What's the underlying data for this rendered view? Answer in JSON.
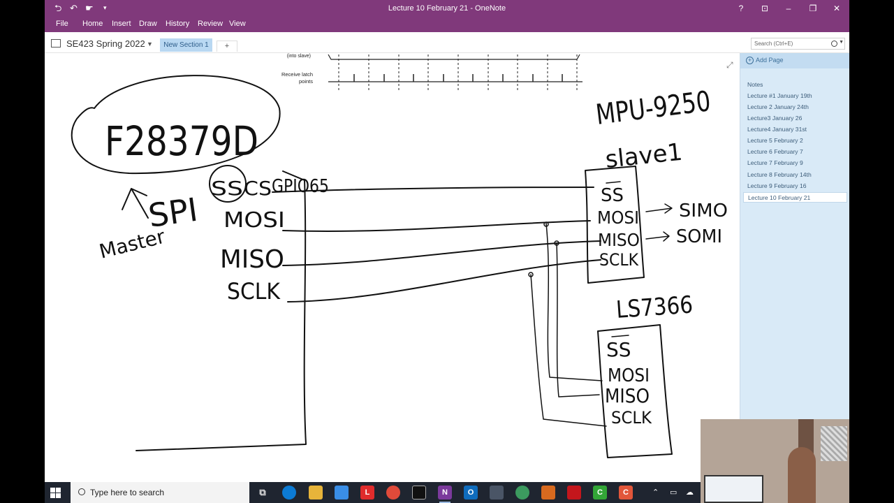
{
  "window": {
    "title": "Lecture 10 February 21 - OneNote",
    "controls": {
      "help": "?",
      "fullscreen": "⊡",
      "minimize": "–",
      "restore": "❐",
      "close": "✕"
    }
  },
  "quick_access": {
    "back": "⮌",
    "undo": "↶",
    "touch": "☛",
    "more": "▾"
  },
  "ribbon": {
    "tabs": [
      "File",
      "Home",
      "Insert",
      "Draw",
      "History",
      "Review",
      "View"
    ]
  },
  "notebook": {
    "name": "SE423 Spring 2022",
    "active_section": "New Section 1",
    "add_section": "+"
  },
  "search": {
    "placeholder": "Search (Ctrl+E)"
  },
  "pages": {
    "add_page": "Add Page",
    "items": [
      "Notes",
      "Lecture #1 January 19th",
      "Lecture 2 January 24th",
      "Lecture3  January 26",
      "Lecture4 January 31st",
      "Lecture 5 February 2",
      "Lecture 6 February 7",
      "Lecture 7 February 9",
      "Lecture 8 February 14th",
      "Lecture 9 February 16",
      "Lecture 10 February 21"
    ],
    "active_index": 10
  },
  "diagram_snippet": {
    "top_label": "(into slave)",
    "receive_label_1": "Receive latch",
    "receive_label_2": "points"
  },
  "ink": {
    "master_chip": "F28379D",
    "master_protocol": "SPI",
    "master_role": "Master",
    "master_pins": [
      "SS",
      "CS",
      "GPIO65",
      "MOSI",
      "MISO",
      "SCLK"
    ],
    "slave_chip": "MPU-9250",
    "slave_role": "slave1",
    "slave_pins": [
      "SS",
      "MOSI",
      "MISO",
      "SCLK"
    ],
    "slave_alias": [
      "SIMO",
      "SOMI"
    ],
    "slave2_chip": "LS7366",
    "slave2_pins": [
      "SS",
      "MOSI",
      "MISO",
      "SCLK"
    ]
  },
  "taskbar": {
    "search_placeholder": "Type here to search"
  }
}
